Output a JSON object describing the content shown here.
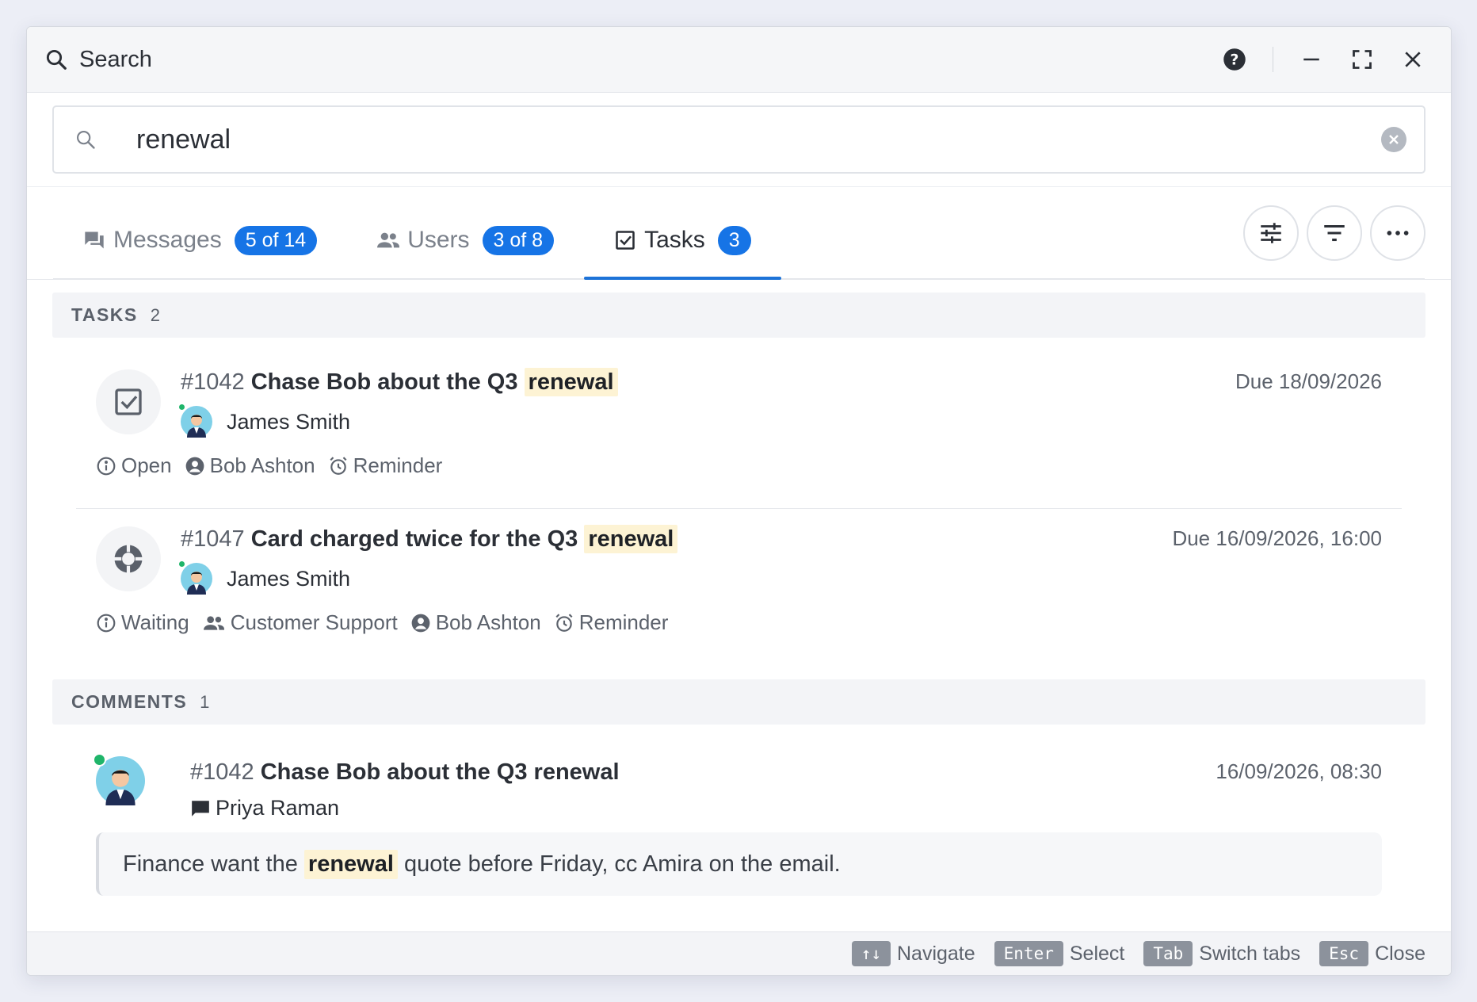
{
  "window": {
    "title": "Search"
  },
  "search": {
    "value": "renewal",
    "placeholder": ""
  },
  "tabs": [
    {
      "label": "Messages",
      "badge": "5 of 14",
      "icon": "messages-icon"
    },
    {
      "label": "Users",
      "badge": "3 of 8",
      "icon": "users-icon"
    },
    {
      "label": "Tasks",
      "badge": "3",
      "icon": "task-check-icon",
      "active": true
    }
  ],
  "sections": {
    "tasks": {
      "label": "TASKS",
      "count": "2"
    },
    "comments": {
      "label": "COMMENTS",
      "count": "1"
    }
  },
  "tasks": [
    {
      "number": "#1042",
      "title_before": "Chase Bob about the Q3",
      "highlight": "renewal",
      "due": "Due 18/09/2026",
      "assignee": "James Smith",
      "meta": {
        "status": "Open",
        "person": "Bob Ashton",
        "reminder": "Reminder"
      }
    },
    {
      "number": "#1047",
      "title_before": "Card charged twice for the Q3",
      "highlight": "renewal",
      "due": "Due 16/09/2026, 16:00",
      "assignee": "James Smith",
      "meta": {
        "status": "Waiting",
        "team": "Customer Support",
        "person": "Bob Ashton",
        "reminder": "Reminder"
      }
    }
  ],
  "comment": {
    "number": "#1042",
    "title": "Chase Bob about the Q3 renewal",
    "date": "16/09/2026, 08:30",
    "author": "Priya Raman",
    "text_before": "Finance want the",
    "highlight": "renewal",
    "text_after": "quote before Friday, cc Amira on the email."
  },
  "footer": {
    "hints": [
      {
        "key": "↑↓",
        "label": "Navigate"
      },
      {
        "key": "Enter",
        "label": "Select"
      },
      {
        "key": "Tab",
        "label": "Switch tabs"
      },
      {
        "key": "Esc",
        "label": "Close"
      }
    ]
  },
  "colors": {
    "accent": "#1674e6",
    "highlight": "#fdf3d4",
    "online": "#1fb56a"
  }
}
